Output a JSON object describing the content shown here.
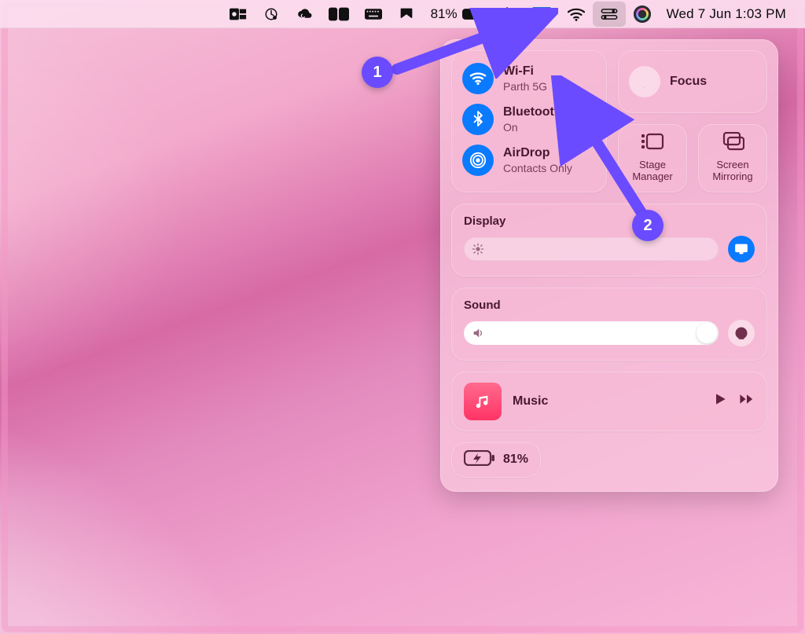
{
  "menubar": {
    "battery_pct": "81%",
    "datetime": "Wed 7 Jun  1:03 PM"
  },
  "control_center": {
    "wifi": {
      "title": "Wi-Fi",
      "subtitle": "Parth 5G",
      "active": true
    },
    "bluetooth": {
      "title": "Bluetooth",
      "subtitle": "On",
      "active": true
    },
    "airdrop": {
      "title": "AirDrop",
      "subtitle": "Contacts Only",
      "active": true
    },
    "focus": {
      "title": "Focus"
    },
    "stage_manager": {
      "label": "Stage Manager"
    },
    "screen_mirroring": {
      "label": "Screen Mirroring"
    },
    "display": {
      "label": "Display"
    },
    "sound": {
      "label": "Sound"
    },
    "music": {
      "app": "Music"
    },
    "battery": {
      "pct": "81%"
    }
  },
  "annotations": {
    "step1": "1",
    "step2": "2"
  }
}
